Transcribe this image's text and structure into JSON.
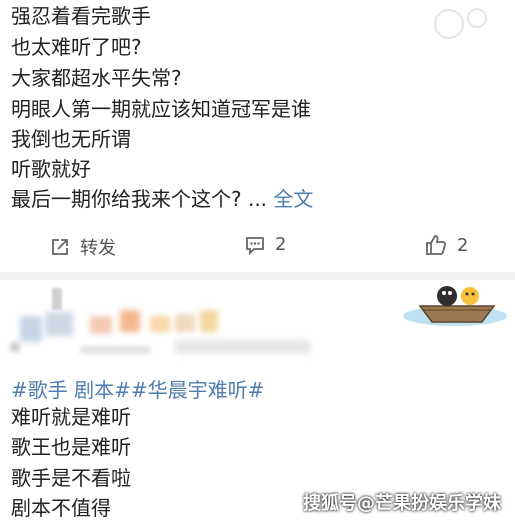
{
  "post1": {
    "lines": [
      "强忍着看完歌手",
      "也太难听了吧?",
      "大家都超水平失常?",
      "明眼人第一期就应该知道冠军是谁",
      "我倒也无所谓",
      "听歌就好",
      "最后一期你给我来个这个? ..."
    ],
    "full_text_link": "全文",
    "actions": {
      "repost_label": "转发",
      "comment_count": "2",
      "like_count": "2"
    }
  },
  "post2": {
    "hashtags": "#歌手 剧本##华晨宇难听#",
    "lines": [
      "难听就是难听",
      "歌王也是难听",
      "歌手是不看啦",
      "剧本不值得"
    ]
  },
  "watermark": "搜狐号@芒果扮娱乐学妹",
  "icons": {
    "repost": "repost-icon",
    "comment": "comment-icon",
    "like": "thumbs-up-icon",
    "boat": "boat-sticker-icon"
  }
}
